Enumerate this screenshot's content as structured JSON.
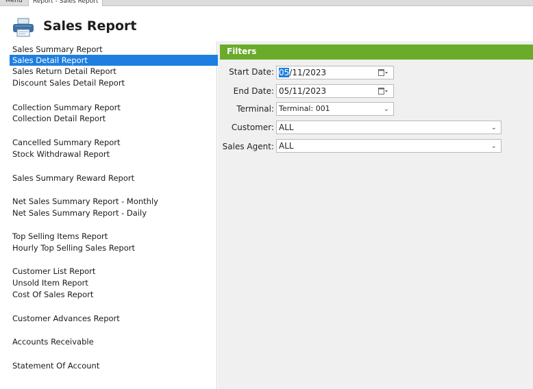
{
  "tabs": {
    "menu": "Menu",
    "active": "Report - Sales Report"
  },
  "header": {
    "title": "Sales Report",
    "icon": "printer-icon"
  },
  "reports": [
    {
      "label": "Sales Summary Report",
      "selected": false
    },
    {
      "label": "Sales Detail Report",
      "selected": true
    },
    {
      "label": "Sales Return Detail Report",
      "selected": false
    },
    {
      "label": "Discount Sales Detail Report",
      "selected": false
    },
    {
      "label": "Collection Summary Report",
      "selected": false
    },
    {
      "label": "Collection Detail Report",
      "selected": false
    },
    {
      "label": "Cancelled Summary Report",
      "selected": false
    },
    {
      "label": "Stock Withdrawal Report",
      "selected": false
    },
    {
      "label": "Sales Summary Reward Report",
      "selected": false
    },
    {
      "label": "Net Sales Summary Report - Monthly",
      "selected": false
    },
    {
      "label": "Net Sales Summary Report - Daily",
      "selected": false
    },
    {
      "label": "Top Selling Items Report",
      "selected": false
    },
    {
      "label": "Hourly Top Selling Sales Report",
      "selected": false
    },
    {
      "label": "Customer List Report",
      "selected": false
    },
    {
      "label": "Unsold Item Report",
      "selected": false
    },
    {
      "label": "Cost Of Sales Report",
      "selected": false
    },
    {
      "label": "Customer Advances Report",
      "selected": false
    },
    {
      "label": "Accounts Receivable",
      "selected": false
    },
    {
      "label": "Statement Of Account",
      "selected": false
    }
  ],
  "filters": {
    "title": "Filters",
    "start_date": {
      "label": "Start Date:",
      "value_highlight": "05",
      "value_rest": "/11/2023"
    },
    "end_date": {
      "label": "End Date:",
      "value": "05/11/2023"
    },
    "terminal": {
      "label": "Terminal:",
      "value": "Terminal: 001"
    },
    "customer": {
      "label": "Customer:",
      "value": "ALL"
    },
    "sales_agent": {
      "label": "Sales Agent:",
      "value": "ALL"
    }
  },
  "colors": {
    "accent_green": "#6aab2a",
    "selection_blue": "#1e7fe0"
  }
}
